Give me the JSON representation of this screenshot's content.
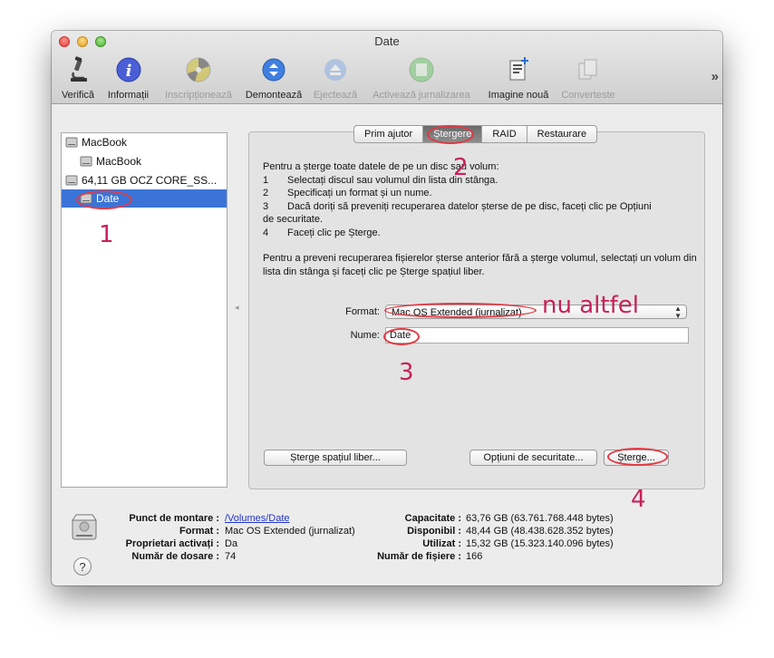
{
  "window": {
    "title": "Date"
  },
  "toolbar": {
    "items": [
      {
        "label": "Verifică",
        "icon": "microscope-icon",
        "enabled": true
      },
      {
        "label": "Informații",
        "icon": "info-icon",
        "enabled": true
      },
      {
        "label": "Inscripționează",
        "icon": "burn-disc-icon",
        "enabled": false
      },
      {
        "label": "Demontează",
        "icon": "unmount-icon",
        "enabled": true
      },
      {
        "label": "Ejectează",
        "icon": "eject-icon",
        "enabled": false
      },
      {
        "label": "Activează jurnalizarea",
        "icon": "journal-icon",
        "enabled": false
      },
      {
        "label": "Imagine nouă",
        "icon": "new-image-icon",
        "enabled": true
      },
      {
        "label": "Converteste",
        "icon": "convert-icon",
        "enabled": false
      }
    ],
    "overflow": "»"
  },
  "sidebar": {
    "items": [
      {
        "label": "MacBook"
      },
      {
        "label": "MacBook"
      },
      {
        "label": "64,11 GB OCZ CORE_SS..."
      },
      {
        "label": "Date"
      }
    ]
  },
  "tabs": {
    "items": [
      {
        "label": "Prim ajutor"
      },
      {
        "label": "Ștergere"
      },
      {
        "label": "RAID"
      },
      {
        "label": "Restaurare"
      }
    ]
  },
  "instructions": {
    "intro": "Pentru a șterge toate datele de pe un disc sau volum:",
    "steps": [
      {
        "n": "1",
        "text": "Selectați discul sau volumul din lista din stânga."
      },
      {
        "n": "2",
        "text": "Specificați un format și un nume."
      },
      {
        "n": "3",
        "text": "Dacă doriți să preveniți recuperarea datelor șterse de pe disc, faceți clic pe Opțiuni"
      },
      {
        "n": "",
        "text": "de securitate."
      },
      {
        "n": "4",
        "text": "Faceți clic pe Șterge."
      }
    ],
    "free_space": "Pentru a preveni recuperarea fișierelor șterse anterior fără a șterge volumul, selectați un volum din lista din stânga și faceți clic pe Șterge spațiul liber."
  },
  "form": {
    "format_label": "Format:",
    "format_value": "Mac OS Extended (jurnalizat)",
    "name_label": "Nume:",
    "name_value": "Date"
  },
  "buttons": {
    "erase_free": "Șterge spațiul liber...",
    "security": "Opțiuni de securitate...",
    "erase": "Șterge..."
  },
  "info": {
    "mount_label": "Punct de montare :",
    "mount_value": "/Volumes/Date",
    "format_label": "Format :",
    "format_value": "Mac OS Extended (jurnalizat)",
    "owners_label": "Proprietari activați :",
    "owners_value": "Da",
    "folders_label": "Număr de dosare :",
    "folders_value": "74",
    "capacity_label": "Capacitate :",
    "capacity_value": "63,76 GB (63.761.768.448 bytes)",
    "available_label": "Disponibil :",
    "available_value": "48,44 GB (48.438.628.352 bytes)",
    "used_label": "Utilizat :",
    "used_value": "15,32 GB (15.323.140.096 bytes)",
    "files_label": "Număr de fișiere :",
    "files_value": "166"
  },
  "annotations": {
    "step1": "1",
    "step2": "2",
    "step3": "3",
    "step4": "4",
    "note": "nu altfel"
  },
  "colors": {
    "selection": "#3a74d8",
    "annotation": "#c8205a",
    "ring": "#e23b45"
  }
}
